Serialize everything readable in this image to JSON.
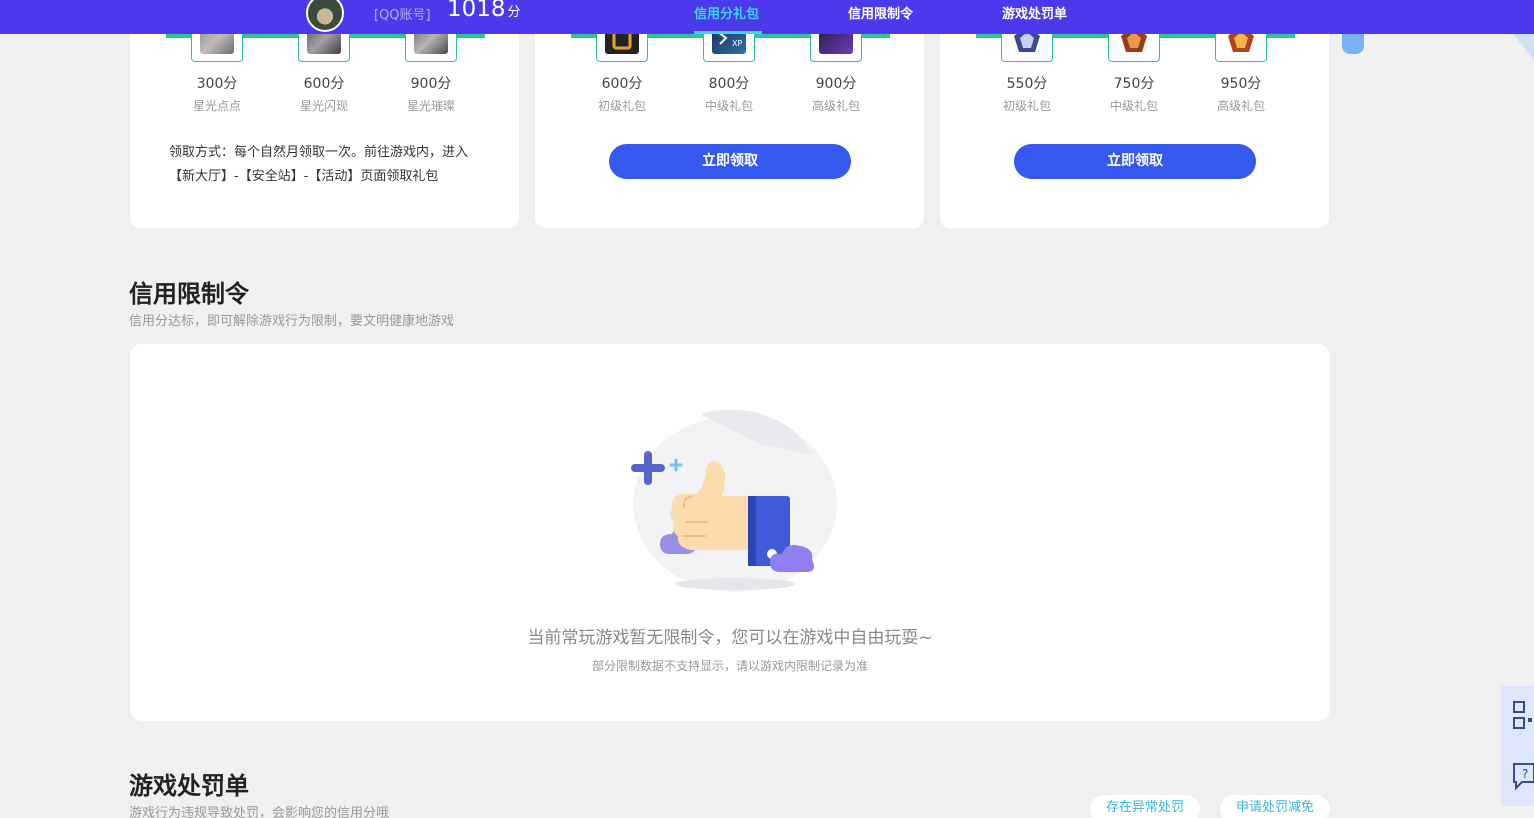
{
  "topbar": {
    "account_label": "[QQ账号]",
    "score": "1018",
    "score_unit": "分",
    "nav": [
      {
        "label": "信用分礼包",
        "active": true
      },
      {
        "label": "信用限制令",
        "active": false
      },
      {
        "label": "游戏处罚单",
        "active": false
      }
    ]
  },
  "gift_cards": [
    {
      "gifts": [
        {
          "points": "300分",
          "name": "星光点点",
          "icon": "skin-icon"
        },
        {
          "points": "600分",
          "name": "星光闪现",
          "icon": "skin-icon"
        },
        {
          "points": "900分",
          "name": "星光璀璨",
          "icon": "skin-icon"
        }
      ],
      "note": "领取方式：每个自然月领取一次。前往游戏内，进入【新大厅】-【安全站】-【活动】页面领取礼包"
    },
    {
      "gifts": [
        {
          "points": "600分",
          "name": "初级礼包",
          "icon": "game-badge-icon"
        },
        {
          "points": "800分",
          "name": "中级礼包",
          "icon": "xp-card-icon"
        },
        {
          "points": "900分",
          "name": "高级礼包",
          "icon": "game-badge-icon"
        }
      ],
      "button": "立即领取"
    },
    {
      "gifts": [
        {
          "points": "550分",
          "name": "初级礼包",
          "icon": "rank-badge-icon"
        },
        {
          "points": "750分",
          "name": "中级礼包",
          "icon": "rank-badge-icon"
        },
        {
          "points": "950分",
          "name": "高级礼包",
          "icon": "rank-badge-icon"
        }
      ],
      "button": "立即领取"
    }
  ],
  "restriction": {
    "title": "信用限制令",
    "subtitle": "信用分达标，即可解除游戏行为限制，要文明健康地游戏",
    "empty_main": "当前常玩游戏暂无限制令，您可以在游戏中自由玩耍~",
    "empty_sub": "部分限制数据不支持显示，请以游戏内限制记录为准"
  },
  "penalty": {
    "title": "游戏处罚单",
    "subtitle": "游戏行为违规导致处罚，会影响您的信用分哦",
    "actions": [
      "存在异常处罚",
      "申请处罚减免"
    ]
  },
  "side_tools": [
    "qr-code-icon",
    "help-chat-icon"
  ],
  "colors": {
    "topbar": "#4a3aeb",
    "active_nav": "#38d7f2",
    "primary_button": "#3559ee",
    "gift_accent": "#2fc39a",
    "link": "#39b6d9"
  }
}
